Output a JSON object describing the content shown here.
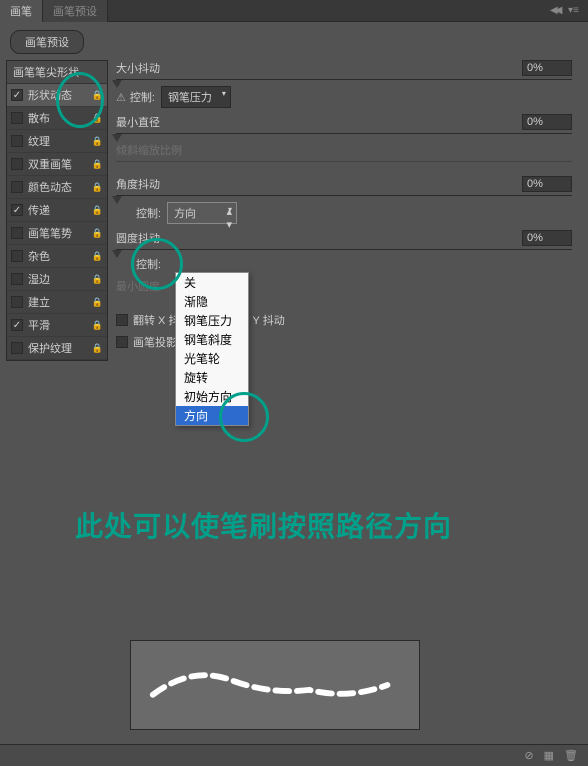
{
  "tabs": {
    "active": "画笔",
    "inactive": "画笔预设"
  },
  "preset_button": "画笔预设",
  "sidebar": {
    "header": "画笔笔尖形状",
    "items": [
      {
        "label": "形状动态",
        "checked": true,
        "selected": true
      },
      {
        "label": "散布",
        "checked": false
      },
      {
        "label": "纹理",
        "checked": false
      },
      {
        "label": "双重画笔",
        "checked": false
      },
      {
        "label": "颜色动态",
        "checked": false
      },
      {
        "label": "传递",
        "checked": true
      },
      {
        "label": "画笔笔势",
        "checked": false
      },
      {
        "label": "杂色",
        "checked": false
      },
      {
        "label": "湿边",
        "checked": false
      },
      {
        "label": "建立",
        "checked": false
      },
      {
        "label": "平滑",
        "checked": true
      },
      {
        "label": "保护纹理",
        "checked": false
      }
    ]
  },
  "settings": {
    "size_jitter": {
      "label": "大小抖动",
      "value": "0%"
    },
    "control1": {
      "label": "控制:",
      "value": "钢笔压力",
      "warn": "⚠"
    },
    "min_diameter": {
      "label": "最小直径",
      "value": "0%"
    },
    "tilt_scale": {
      "label": "倾斜缩放比例"
    },
    "angle_jitter": {
      "label": "角度抖动",
      "value": "0%"
    },
    "control2": {
      "label": "控制:",
      "value": "方向"
    },
    "roundness_jitter": {
      "label": "圆度抖动",
      "value": "0%"
    },
    "control3": {
      "label": "控制:"
    },
    "min_roundness": {
      "label": "最小圆度"
    },
    "flip_x": "翻转 X 抖动",
    "flip_y": "翻转 Y 抖动",
    "brush_projection": "画笔投影"
  },
  "dropdown_options": [
    "关",
    "渐隐",
    "钢笔压力",
    "钢笔斜度",
    "光笔轮",
    "旋转",
    "初始方向",
    "方向"
  ],
  "annotation": "此处可以使笔刷按照路径方向"
}
